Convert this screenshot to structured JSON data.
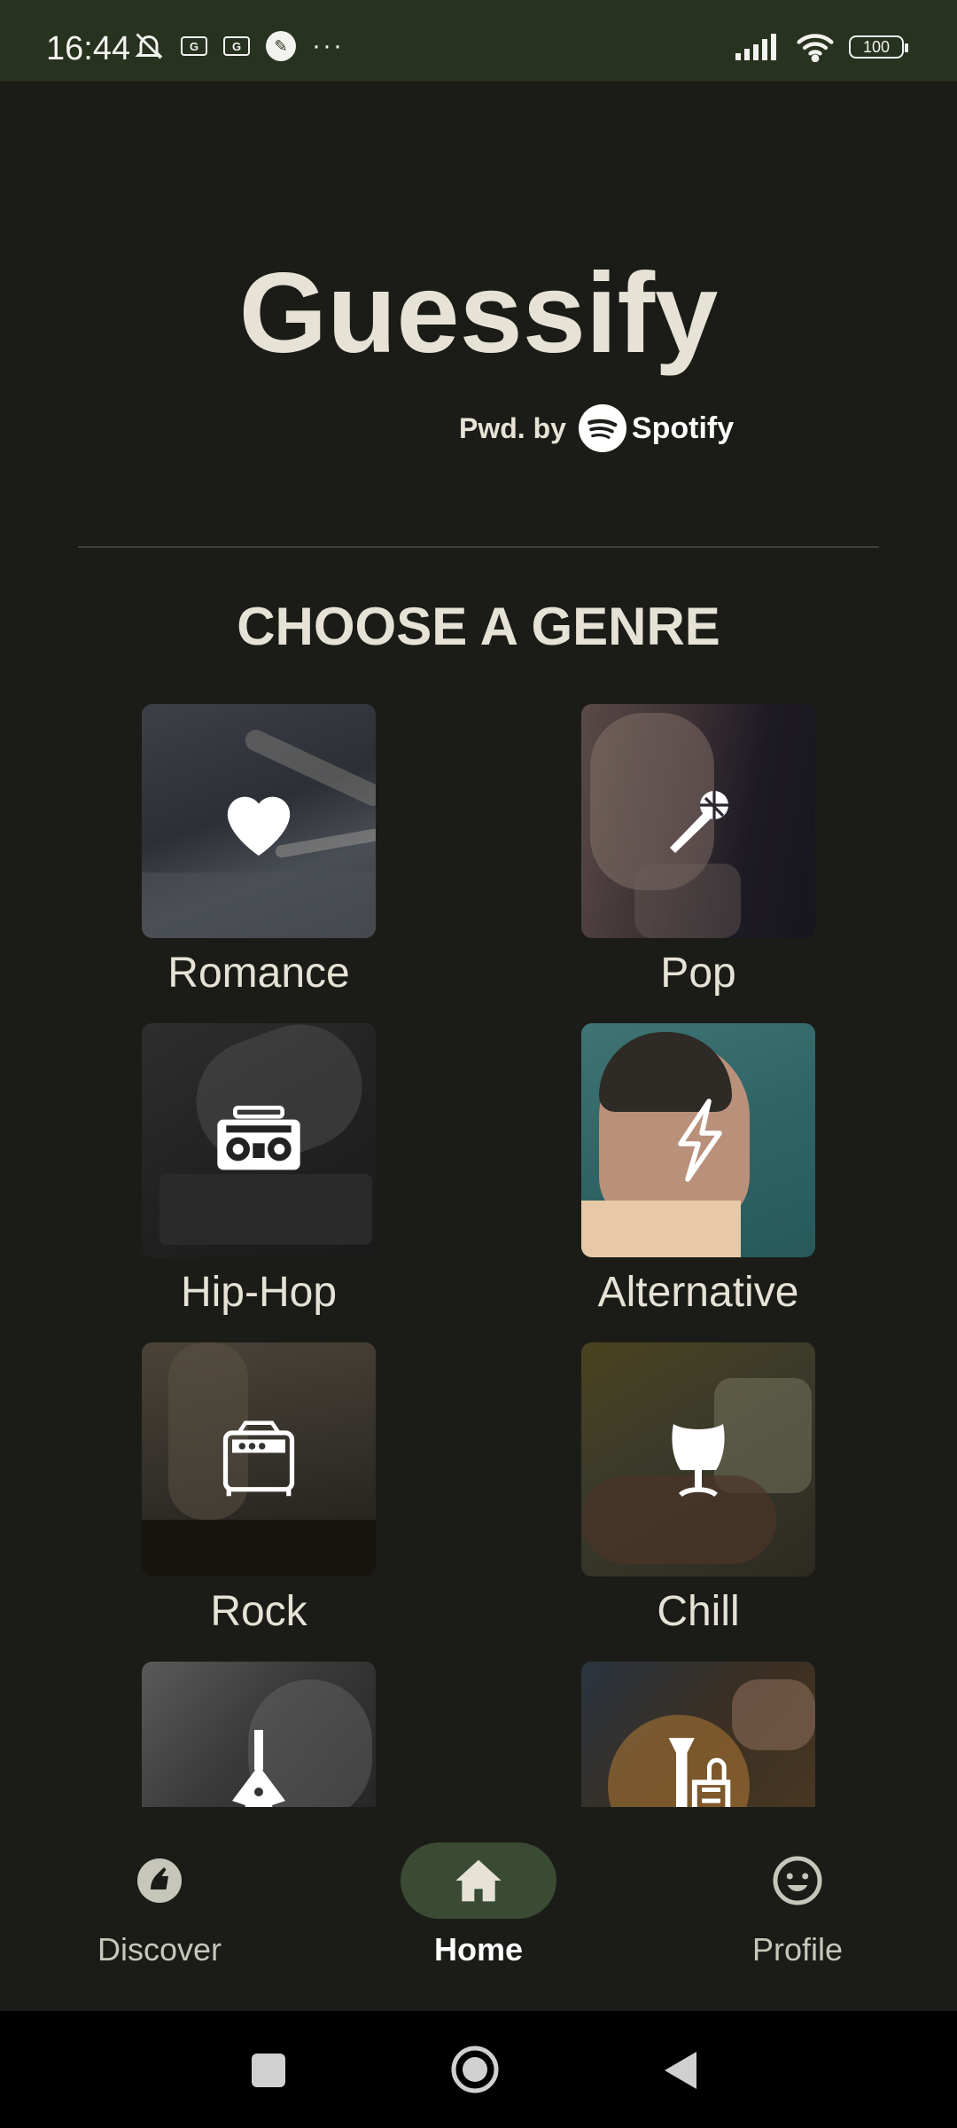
{
  "status_bar": {
    "time": "16:44",
    "battery": "100"
  },
  "header": {
    "app_title": "Guessify",
    "powered_by": "Pwd. by",
    "spotify_wordmark": "Spotify"
  },
  "section": {
    "title": "CHOOSE A GENRE"
  },
  "genres": [
    {
      "label": "Romance",
      "icon": "heart-icon"
    },
    {
      "label": "Pop",
      "icon": "microphone-icon"
    },
    {
      "label": "Hip-Hop",
      "icon": "boombox-icon"
    },
    {
      "label": "Alternative",
      "icon": "lightning-icon"
    },
    {
      "label": "Rock",
      "icon": "amplifier-icon"
    },
    {
      "label": "Chill",
      "icon": "egg-chair-icon"
    },
    {
      "label": "",
      "icon": "electric-guitar-icon"
    },
    {
      "label": "",
      "icon": "brass-instruments-icon"
    }
  ],
  "bottom_nav": {
    "items": [
      {
        "label": "Discover",
        "icon": "discover-icon",
        "active": false
      },
      {
        "label": "Home",
        "icon": "home-icon",
        "active": true
      },
      {
        "label": "Profile",
        "icon": "smiley-icon",
        "active": false
      }
    ]
  },
  "colors": {
    "background": "#1b1c18",
    "status_bar": "#27321f",
    "accent_pill": "#3a4a33",
    "text": "#e6e3d6"
  }
}
